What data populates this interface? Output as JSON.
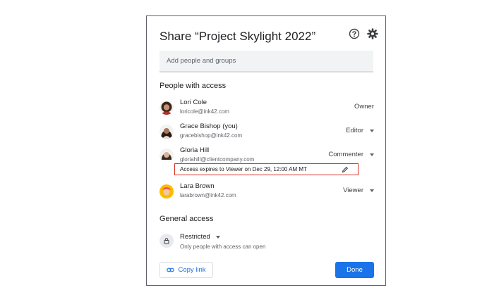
{
  "dialog": {
    "title": "Share “Project Skylight 2022”",
    "help_icon": "help-icon",
    "settings_icon": "gear-icon"
  },
  "add_people": {
    "placeholder": "Add people and groups"
  },
  "people_section": {
    "heading": "People with access",
    "people": [
      {
        "name": "Lori Cole",
        "email": "loricole@ink42.com",
        "role": "Owner"
      },
      {
        "name": "Grace Bishop (you)",
        "email": "gracebishop@ink42.com",
        "role": "Editor"
      },
      {
        "name": "Gloria Hill",
        "email": "gloriahill@clientcompany.com",
        "role": "Commenter",
        "expiry_note": "Access expires to Viewer on Dec 29, 12:00 AM MT"
      },
      {
        "name": "Lara Brown",
        "email": "larabrown@ink42.com",
        "role": "Viewer"
      }
    ]
  },
  "general_access": {
    "heading": "General access",
    "selected": "Restricted",
    "description": "Only people with access can open"
  },
  "footer": {
    "copy_link_label": "Copy link",
    "done_label": "Done"
  },
  "colors": {
    "accent": "#1a73e8",
    "highlight_border": "#d93025"
  }
}
